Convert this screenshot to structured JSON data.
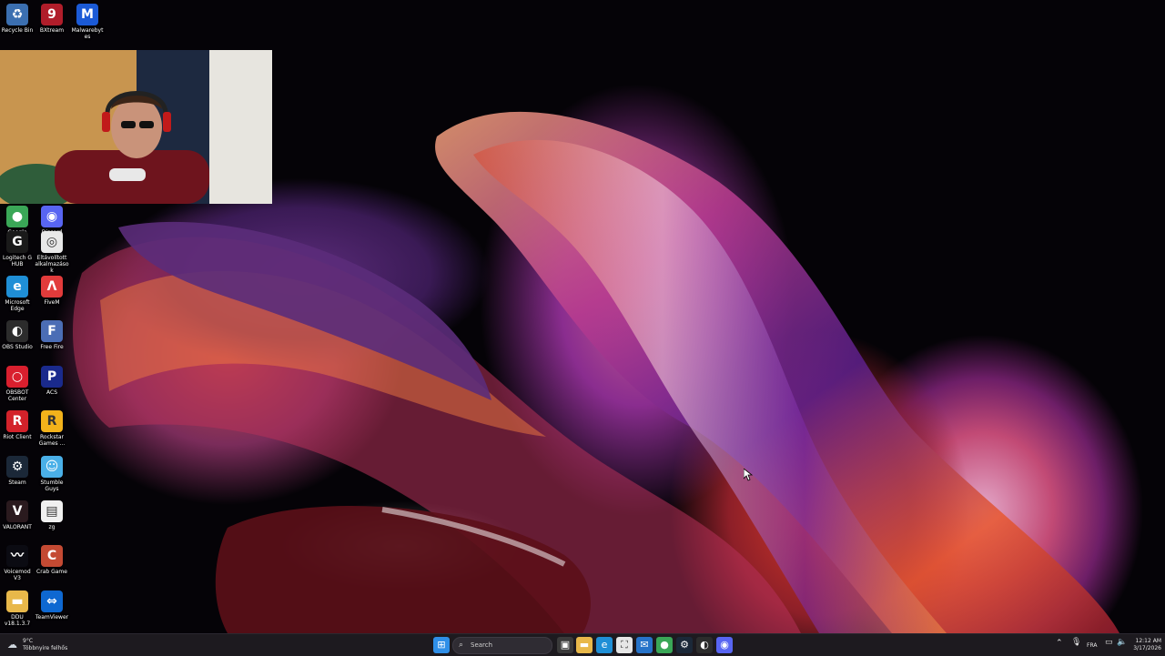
{
  "desktop": {
    "icons": [
      {
        "label": "Recycle Bin",
        "icon": "recycle-bin-icon",
        "color": "#3b6fb0",
        "glyph": "♻"
      },
      {
        "label": "BXtream",
        "icon": "bxtream-icon",
        "color": "#b01d2a",
        "glyph": "9"
      },
      {
        "label": "Malwarebytes",
        "icon": "malwarebytes-icon",
        "color": "#1b5ad6",
        "glyph": "M"
      },
      {
        "label": "Google Chrome",
        "icon": "chrome-icon",
        "color": "#3aa757",
        "glyph": "●"
      },
      {
        "label": "Discord",
        "icon": "discord-icon",
        "color": "#5865f2",
        "glyph": "◉"
      },
      {
        "label": "Logitech G HUB",
        "icon": "logitech-icon",
        "color": "#1a1a1a",
        "glyph": "G"
      },
      {
        "label": "Eltávolított alkalmazások",
        "icon": "chrome-shortcut-icon",
        "color": "#e8e8e8",
        "glyph": "◎"
      },
      {
        "label": "Microsoft Edge",
        "icon": "edge-icon",
        "color": "#1f8fd6",
        "glyph": "e"
      },
      {
        "label": "FiveM",
        "icon": "fivem-icon",
        "color": "#e23b3b",
        "glyph": "Λ"
      },
      {
        "label": "OBS Studio",
        "icon": "obs-icon",
        "color": "#2c2c2c",
        "glyph": "◐"
      },
      {
        "label": "Free Fire",
        "icon": "free-fire-icon",
        "color": "#4b6db5",
        "glyph": "F"
      },
      {
        "label": "OBSBOT Center",
        "icon": "obsbot-icon",
        "color": "#d91f2e",
        "glyph": "○"
      },
      {
        "label": "ACS",
        "icon": "acs-icon",
        "color": "#1a2a8c",
        "glyph": "P"
      },
      {
        "label": "Riot Client",
        "icon": "riot-client-icon",
        "color": "#d3222a",
        "glyph": "R"
      },
      {
        "label": "Rockstar Games ...",
        "icon": "rockstar-icon",
        "color": "#f2b21b",
        "glyph": "R"
      },
      {
        "label": "Steam",
        "icon": "steam-icon",
        "color": "#1b2838",
        "glyph": "⚙"
      },
      {
        "label": "Stumble Guys",
        "icon": "stumble-guys-icon",
        "color": "#4ab0e8",
        "glyph": "☺"
      },
      {
        "label": "VALORANT",
        "icon": "valorant-icon",
        "color": "#2a1a1e",
        "glyph": "V"
      },
      {
        "label": "zg",
        "icon": "file-icon",
        "color": "#f0f0f0",
        "glyph": "▤"
      },
      {
        "label": "Voicemod V3",
        "icon": "voicemod-icon",
        "color": "#0b0b12",
        "glyph": "〰"
      },
      {
        "label": "Crab Game",
        "icon": "crab-game-icon",
        "color": "#c44a33",
        "glyph": "C"
      },
      {
        "label": "DDU v18.1.3.7",
        "icon": "folder-icon",
        "color": "#e8b84a",
        "glyph": "▬"
      },
      {
        "label": "TeamViewer",
        "icon": "teamviewer-icon",
        "color": "#0e68d1",
        "glyph": "⇔"
      }
    ]
  },
  "taskbar": {
    "weather": {
      "temp": "9°C",
      "desc": "Többnyire felhős",
      "icon": "weather-cloud-icon"
    },
    "search_placeholder": "Search",
    "apps": [
      {
        "name": "start",
        "icon": "windows-start-icon",
        "color": "#2f8fe8",
        "glyph": "⊞"
      },
      {
        "name": "task-view",
        "icon": "task-view-icon",
        "color": "#3a3a3a",
        "glyph": "▣"
      },
      {
        "name": "file-explorer",
        "icon": "folder-icon",
        "color": "#e8b84a",
        "glyph": "▬"
      },
      {
        "name": "edge",
        "icon": "edge-icon",
        "color": "#1f8fd6",
        "glyph": "e"
      },
      {
        "name": "store",
        "icon": "store-icon",
        "color": "#e6e6e6",
        "glyph": "⛶"
      },
      {
        "name": "mail",
        "icon": "mail-icon",
        "color": "#2673c9",
        "glyph": "✉"
      },
      {
        "name": "chrome",
        "icon": "chrome-icon",
        "color": "#3aa757",
        "glyph": "●"
      },
      {
        "name": "steam",
        "icon": "steam-icon",
        "color": "#1b2838",
        "glyph": "⚙"
      },
      {
        "name": "obs",
        "icon": "obs-icon",
        "color": "#2c2c2c",
        "glyph": "◐"
      },
      {
        "name": "discord",
        "icon": "discord-icon",
        "color": "#5865f2",
        "glyph": "◉"
      }
    ],
    "tray": {
      "language": "FRA",
      "time": "12:12 AM",
      "date": "3/17/2026"
    }
  }
}
